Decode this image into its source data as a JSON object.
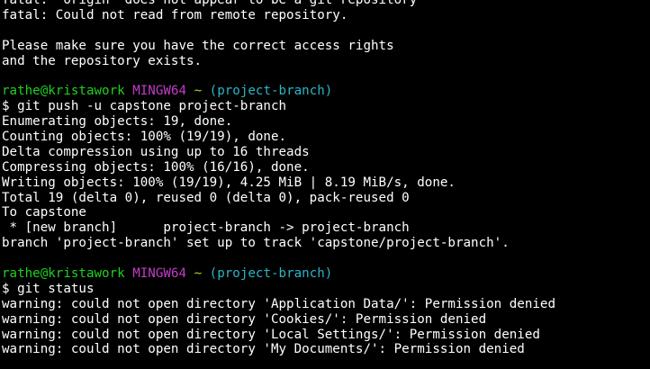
{
  "terminal": {
    "block1": [
      "fatal: 'origin' does not appear to be a git repository",
      "fatal: Could not read from remote repository.",
      "",
      "Please make sure you have the correct access rights",
      "and the repository exists.",
      ""
    ],
    "prompt1": {
      "user_host": "rathe@kristawork",
      "system": "MINGW64",
      "path": "~",
      "branch": "(project-branch)"
    },
    "command1": "$ git push -u capstone project-branch",
    "block2": [
      "Enumerating objects: 19, done.",
      "Counting objects: 100% (19/19), done.",
      "Delta compression using up to 16 threads",
      "Compressing objects: 100% (16/16), done.",
      "Writing objects: 100% (19/19), 4.25 MiB | 8.19 MiB/s, done.",
      "Total 19 (delta 0), reused 0 (delta 0), pack-reused 0",
      "To capstone",
      " * [new branch]      project-branch -> project-branch",
      "branch 'project-branch' set up to track 'capstone/project-branch'.",
      ""
    ],
    "prompt2": {
      "user_host": "rathe@kristawork",
      "system": "MINGW64",
      "path": "~",
      "branch": "(project-branch)"
    },
    "command2": "$ git status",
    "block3": [
      "warning: could not open directory 'Application Data/': Permission denied",
      "warning: could not open directory 'Cookies/': Permission denied",
      "warning: could not open directory 'Local Settings/': Permission denied",
      "warning: could not open directory 'My Documents/': Permission denied"
    ],
    "colors": {
      "background": "#000000",
      "text": "#ffffff",
      "user_host": "#1fd11f",
      "system": "#c33cc8",
      "path": "#c8c81e",
      "branch": "#2bb6c6"
    }
  }
}
